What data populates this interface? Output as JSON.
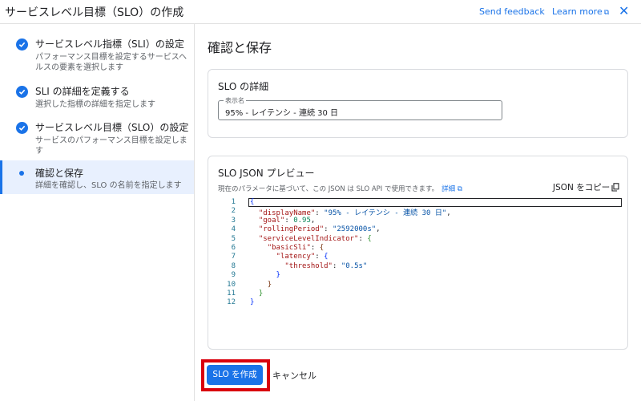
{
  "header": {
    "title": "サービスレベル目標（SLO）の作成",
    "send_feedback": "Send feedback",
    "learn_more": "Learn more"
  },
  "steps": [
    {
      "title": "サービスレベル指標（SLI）の設定",
      "desc": "パフォーマンス目標を設定するサービスヘルスの要素を選択します",
      "status": "complete"
    },
    {
      "title": "SLI の詳細を定義する",
      "desc": "選択した指標の詳細を指定します",
      "status": "complete"
    },
    {
      "title": "サービスレベル目標（SLO）の設定",
      "desc": "サービスのパフォーマンス目標を設定します",
      "status": "complete"
    },
    {
      "title": "確認と保存",
      "desc": "詳細を確認し、SLO の名前を指定します",
      "status": "active"
    }
  ],
  "main": {
    "heading": "確認と保存",
    "details_card": {
      "title": "SLO の詳細",
      "field_label": "表示名",
      "field_value": "95% - レイテンシ - 連続 30 日"
    },
    "json_card": {
      "title": "SLO JSON プレビュー",
      "desc": "現在のパラメータに基づいて、この JSON は SLO API で使用できます。",
      "desc_link": "詳細",
      "copy_label": "JSON をコピー",
      "line_numbers": [
        "1",
        "2",
        "3",
        "4",
        "5",
        "6",
        "7",
        "8",
        "9",
        "10",
        "11",
        "12"
      ]
    },
    "actions": {
      "create_label": "SLO を作成",
      "cancel_label": "キャンセル"
    }
  },
  "code_json": {
    "displayName": "95% - レイテンシ - 連続 30 日",
    "goal": "0.95",
    "rollingPeriod": "2592000s",
    "threshold": "0.5s"
  },
  "icons": {
    "check": "check-circle-icon",
    "external": "external-link-icon",
    "copy": "copy-icon",
    "close": "close-icon"
  },
  "colors": {
    "accent": "#1a73e8",
    "highlight": "#d9000d",
    "active_bg": "#e8f0fe"
  }
}
